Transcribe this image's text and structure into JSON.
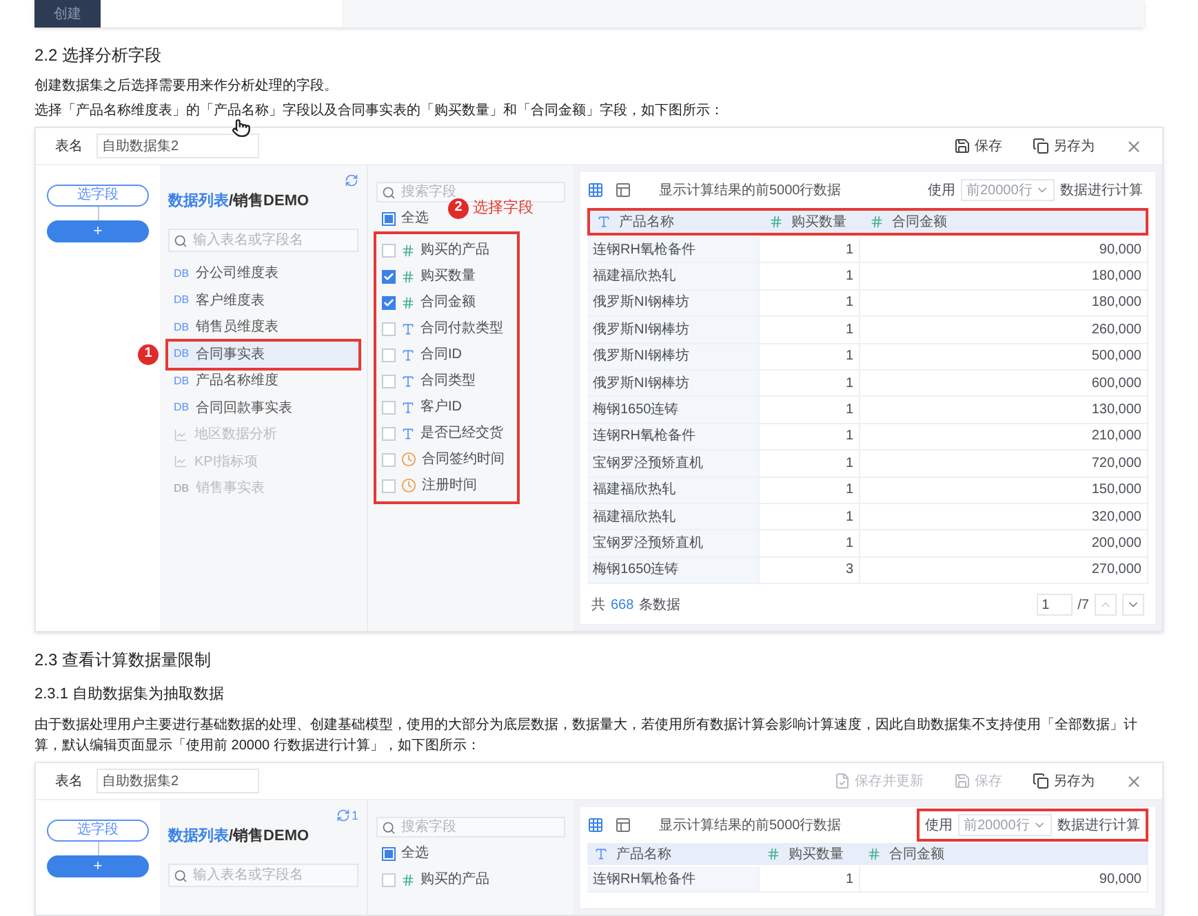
{
  "intro_strip": {
    "button": "创建"
  },
  "blocks": [
    {
      "kind": "heading",
      "text": "2.2 选择分析字段"
    },
    {
      "kind": "paragraph",
      "text": "创建数据集之后选择需要用来作分析处理的字段。"
    },
    {
      "kind": "paragraph",
      "text": "选择「产品名称维度表」的「产品名称」字段以及合同事实表的「购买数量」和「合同金额」字段，如下图所示："
    },
    {
      "kind": "dialog",
      "clipped": false,
      "table_name": {
        "label": "表名",
        "value": "自助数据集2"
      },
      "actions": [
        {
          "kind": "save",
          "label": "保存",
          "disabled": false
        },
        {
          "kind": "save_as",
          "label": "另存为",
          "disabled": false
        }
      ],
      "steps": {
        "select": "选字段",
        "add": "+"
      },
      "source": {
        "title_link": "数据列表",
        "title_rest": "/销售DEMO",
        "search_placeholder": "输入表名或字段名",
        "tables": [
          {
            "kind": "db",
            "tag": "DB",
            "label": "分公司维度表",
            "selected": false,
            "disabled": false,
            "highlight": false
          },
          {
            "kind": "db",
            "tag": "DB",
            "label": "客户维度表",
            "selected": false,
            "disabled": false,
            "highlight": false
          },
          {
            "kind": "db",
            "tag": "DB",
            "label": "销售员维度表",
            "selected": false,
            "disabled": false,
            "highlight": false
          },
          {
            "kind": "db",
            "tag": "DB",
            "label": "合同事实表",
            "selected": true,
            "disabled": false,
            "highlight": true,
            "marker": "1"
          },
          {
            "kind": "db",
            "tag": "DB",
            "label": "产品名称维度",
            "selected": false,
            "disabled": false,
            "highlight": false
          },
          {
            "kind": "db",
            "tag": "DB",
            "label": "合同回款事实表",
            "selected": false,
            "disabled": false,
            "highlight": false
          },
          {
            "kind": "analysis",
            "label": "地区数据分析",
            "selected": false,
            "disabled": true,
            "highlight": false
          },
          {
            "kind": "analysis",
            "label": "KPI指标项",
            "selected": false,
            "disabled": true,
            "highlight": false
          },
          {
            "kind": "db",
            "tag": "DB",
            "label": "销售事实表",
            "selected": false,
            "disabled": true,
            "highlight": false
          }
        ]
      },
      "fields": {
        "search_placeholder": "搜索字段",
        "select_all": {
          "label": "全选",
          "indeterminate": true
        },
        "highlight": true,
        "marker": "2",
        "marker_label": "选择字段",
        "items": [
          {
            "kind": "number",
            "label": "购买的产品",
            "checked": false
          },
          {
            "kind": "number",
            "label": "购买数量",
            "checked": true
          },
          {
            "kind": "number",
            "label": "合同金额",
            "checked": true
          },
          {
            "kind": "text",
            "label": "合同付款类型",
            "checked": false
          },
          {
            "kind": "text",
            "label": "合同ID",
            "checked": false
          },
          {
            "kind": "text",
            "label": "合同类型",
            "checked": false
          },
          {
            "kind": "text",
            "label": "客户ID",
            "checked": false
          },
          {
            "kind": "text",
            "label": "是否已经交货",
            "checked": false
          },
          {
            "kind": "date",
            "label": "合同签约时间",
            "checked": false
          },
          {
            "kind": "date",
            "label": "注册时间",
            "checked": false
          }
        ]
      },
      "preview": {
        "view_modes": [
          {
            "kind": "grid",
            "selected": true
          },
          {
            "kind": "panel",
            "selected": false
          }
        ],
        "note": "显示计算结果的前5000行数据",
        "limit": {
          "prefix": "使用",
          "value": "前20000行",
          "suffix": "数据进行计算",
          "highlight": false
        },
        "header_highlight": true,
        "columns": [
          {
            "kind": "text",
            "label": "产品名称"
          },
          {
            "kind": "number",
            "label": "购买数量"
          },
          {
            "kind": "number",
            "label": "合同金额"
          }
        ],
        "rows": [
          [
            "连钢RH氧枪备件",
            "1",
            "90,000"
          ],
          [
            "福建福欣热轧",
            "1",
            "180,000"
          ],
          [
            "俄罗斯NI钢棒坊",
            "1",
            "180,000"
          ],
          [
            "俄罗斯NI钢棒坊",
            "1",
            "260,000"
          ],
          [
            "俄罗斯NI钢棒坊",
            "1",
            "500,000"
          ],
          [
            "俄罗斯NI钢棒坊",
            "1",
            "600,000"
          ],
          [
            "梅钢1650连铸",
            "1",
            "130,000"
          ],
          [
            "连钢RH氧枪备件",
            "1",
            "210,000"
          ],
          [
            "宝钢罗泾预矫直机",
            "1",
            "720,000"
          ],
          [
            "福建福欣热轧",
            "1",
            "150,000"
          ],
          [
            "福建福欣热轧",
            "1",
            "320,000"
          ],
          [
            "宝钢罗泾预矫直机",
            "1",
            "200,000"
          ],
          [
            "梅钢1650连铸",
            "3",
            "270,000"
          ]
        ],
        "footer": {
          "prefix": "共",
          "count": "668",
          "suffix": "条数据",
          "page": "1",
          "total": "/7"
        }
      }
    },
    {
      "kind": "heading",
      "text": "2.3 查看计算数据量限制"
    },
    {
      "kind": "subheading",
      "text": "2.3.1 自助数据集为抽取数据"
    },
    {
      "kind": "paragraph",
      "text": "由于数据处理用户主要进行基础数据的处理、创建基础模型，使用的大部分为底层数据，数据量大，若使用所有数据计算会影响计算速度，因此自助数据集不支持使用「全部数据」计算，默认编辑页面显示「使用前 20000 行数据进行计算」，如下图所示："
    },
    {
      "kind": "dialog",
      "clipped": true,
      "table_name": {
        "label": "表名",
        "value": "自助数据集2"
      },
      "actions": [
        {
          "kind": "save_update",
          "label": "保存并更新",
          "disabled": true
        },
        {
          "kind": "save",
          "label": "保存",
          "disabled": true
        },
        {
          "kind": "save_as",
          "label": "另存为",
          "disabled": false
        }
      ],
      "steps": {
        "select": "选字段",
        "add": "+"
      },
      "source": {
        "title_link": "数据列表",
        "title_rest": "/销售DEMO",
        "refresh_badge": "1",
        "search_placeholder": "输入表名或字段名"
      },
      "fields": {
        "search_placeholder": "搜索字段",
        "select_all": {
          "label": "全选",
          "indeterminate": true
        },
        "highlight": false,
        "items": [
          {
            "kind": "number",
            "label": "购买的产品",
            "checked": false
          }
        ]
      },
      "preview": {
        "view_modes": [
          {
            "kind": "grid",
            "selected": true
          },
          {
            "kind": "panel",
            "selected": false
          }
        ],
        "note": "显示计算结果的前5000行数据",
        "limit": {
          "prefix": "使用",
          "value": "前20000行",
          "suffix": "数据进行计算",
          "highlight": true
        },
        "header_highlight": false,
        "columns": [
          {
            "kind": "text",
            "label": "产品名称"
          },
          {
            "kind": "number",
            "label": "购买数量"
          },
          {
            "kind": "number",
            "label": "合同金额"
          }
        ],
        "rows": [
          [
            "连钢RH氧枪备件",
            "1",
            "90,000"
          ]
        ]
      }
    }
  ]
}
